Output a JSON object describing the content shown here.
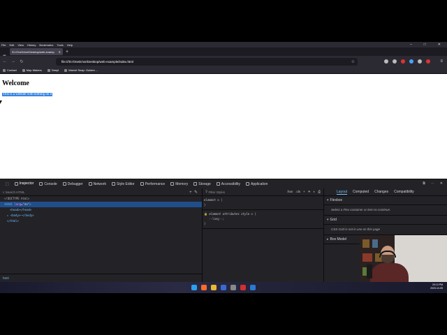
{
  "browser": {
    "menu": [
      "File",
      "Edit",
      "View",
      "History",
      "Bookmarks",
      "Tools",
      "Help"
    ],
    "tab_title": "/D:/OneDrive/Desktop/web-examp",
    "url": "file:///D:/OneDrive/Desktop/web-example/index.html",
    "bookmarks": [
      "Contact",
      "Map Makers",
      "Deepl",
      "Marvel Snap: Golden ..."
    ]
  },
  "page": {
    "heading": "Welcome",
    "paragraph": "This is a website with nothing on it"
  },
  "devtools": {
    "tabs": [
      "Inspector",
      "Console",
      "Debugger",
      "Network",
      "Style Editor",
      "Performance",
      "Memory",
      "Storage",
      "Accessibility",
      "Application"
    ],
    "search_placeholder": "Search HTML",
    "markup": {
      "doctype": "<!DOCTYPE html>",
      "html_open_tag": "<html",
      "html_attr": "lang",
      "html_val": "\"en\"",
      "head": "<head></head>",
      "body": "<body>",
      "body_close": "</body>",
      "html_close": "</html>"
    },
    "breadcrumb": "html",
    "filter_placeholder": "Filter Styles",
    "filter_tools": [
      ":hov",
      ".cls",
      "+"
    ],
    "rule1_selector": "element",
    "rule1_brace": "{",
    "rule1_close": "}",
    "rule2_selector": "element attributes style",
    "rule2_prop": "--lang--;",
    "rule2_close": "}",
    "right_tabs": [
      "Layout",
      "Computed",
      "Changes",
      "Compatibility"
    ],
    "flexbox_title": "Flexbox",
    "flexbox_msg": "Select a Flex container or item to continue.",
    "grid_title": "Grid",
    "grid_msg": "CSS Grid is not in use on this page",
    "boxmodel_title": "Box Model"
  },
  "taskbar": {
    "time": "20:13 PM",
    "date": "2023-10-05"
  },
  "colors": {
    "selection": "#3584e4",
    "devtools_bg": "#232327",
    "accent": "#75bfff"
  }
}
